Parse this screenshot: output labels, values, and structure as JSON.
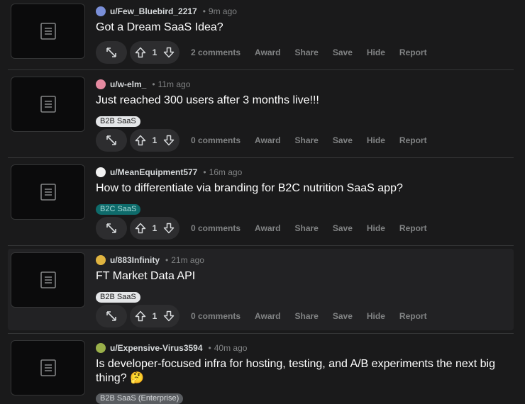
{
  "labels": {
    "award": "Award",
    "share": "Share",
    "save": "Save",
    "hide": "Hide",
    "report": "Report"
  },
  "posts": [
    {
      "user": "u/Few_Bluebird_2217",
      "time": "9m ago",
      "title": "Got a Dream SaaS Idea?",
      "flair": "",
      "votes": "1",
      "comments": "2 comments",
      "avatar_color": "#7a8fd8"
    },
    {
      "user": "u/w-elm_",
      "time": "11m ago",
      "title": "Just reached 300 users after 3 months live!!!",
      "flair": "B2B SaaS",
      "votes": "1",
      "comments": "0 comments",
      "avatar_color": "#e58aa0"
    },
    {
      "user": "u/MeanEquipment577",
      "time": "16m ago",
      "title": "How to differentiate via branding for B2C nutrition SaaS app?",
      "flair": "B2C SaaS",
      "votes": "1",
      "comments": "0 comments",
      "avatar_color": "#f2f2f2"
    },
    {
      "user": "u/883Infinity",
      "time": "21m ago",
      "title": "FT Market Data API",
      "flair": "B2B SaaS",
      "votes": "1",
      "comments": "0 comments",
      "avatar_color": "#e0b440"
    },
    {
      "user": "u/Expensive-Virus3594",
      "time": "40m ago",
      "title": "Is developer-focused infra for hosting, testing, and A/B experiments the next big thing? 🤔",
      "flair": "B2B SaaS (Enterprise)",
      "votes": "",
      "comments": "",
      "avatar_color": "#9ab04a"
    }
  ]
}
